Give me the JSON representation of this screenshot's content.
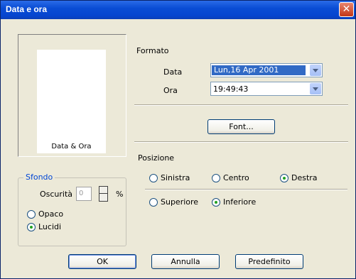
{
  "dialog": {
    "title": "Data e ora"
  },
  "preview": {
    "text": "Data & Ora"
  },
  "formato": {
    "heading": "Formato",
    "data_label": "Data",
    "data_value": "Lun,16 Apr 2001",
    "ora_label": "Ora",
    "ora_value": "19:49:43",
    "font_button": "Font..."
  },
  "sfondo": {
    "legend": "Sfondo",
    "oscurita_label": "Oscurità",
    "oscurita_value": "0",
    "percent": "%",
    "opaco_label": "Opaco",
    "lucidi_label": "Lucidi",
    "selected": "lucidi"
  },
  "posizione": {
    "heading": "Posizione",
    "sinistra": "Sinistra",
    "centro": "Centro",
    "destra": "Destra",
    "horizontal_selected": "destra",
    "superiore": "Superiore",
    "inferiore": "Inferiore",
    "vertical_selected": "inferiore"
  },
  "buttons": {
    "ok": "OK",
    "annulla": "Annulla",
    "predefinito": "Predefinito"
  },
  "icons": {
    "close": "close-icon"
  },
  "colors": {
    "titlebar": "#0a4dd4",
    "legend": "#0046d5",
    "selection": "#316ac5"
  }
}
